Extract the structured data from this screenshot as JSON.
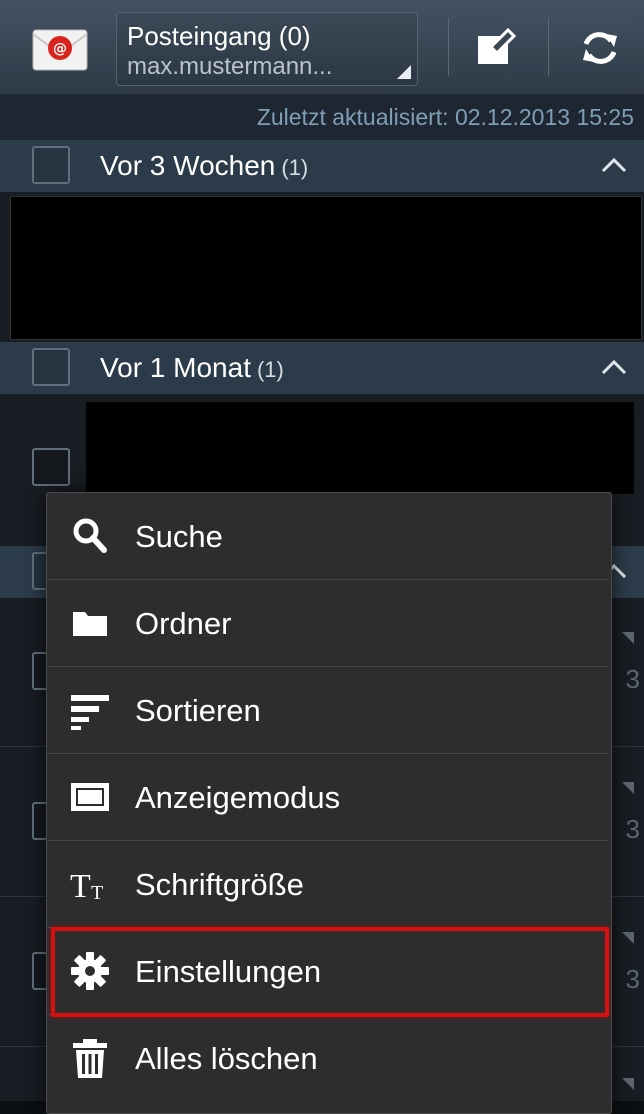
{
  "header": {
    "folder_title": "Posteingang (0)",
    "account": "max.mustermann...",
    "app_icon": "email-app-icon",
    "compose_icon": "compose-icon",
    "refresh_icon": "refresh-icon"
  },
  "updated": {
    "text": "Zuletzt aktualisiert:  02.12.2013 15:25"
  },
  "sections": [
    {
      "title": "Vor 3 Wochen",
      "count": "(1)"
    },
    {
      "title": "Vor 1 Monat",
      "count": "(1)"
    }
  ],
  "peek": {
    "digits": [
      "3",
      "3",
      "3"
    ]
  },
  "menu": {
    "items": [
      {
        "label": "Suche",
        "icon": "search-icon"
      },
      {
        "label": "Ordner",
        "icon": "folder-icon"
      },
      {
        "label": "Sortieren",
        "icon": "sort-icon"
      },
      {
        "label": "Anzeigemodus",
        "icon": "display-mode-icon"
      },
      {
        "label": "Schriftgröße",
        "icon": "font-size-icon"
      },
      {
        "label": "Einstellungen",
        "icon": "settings-gear-icon",
        "highlighted": true
      },
      {
        "label": "Alles löschen",
        "icon": "trash-icon"
      }
    ]
  },
  "colors": {
    "actionbar": "#3a4856",
    "section_header": "#2c3b49",
    "menu_bg": "#2d2d2d",
    "highlight": "#d41010",
    "updated_text": "#7f9fb6"
  }
}
